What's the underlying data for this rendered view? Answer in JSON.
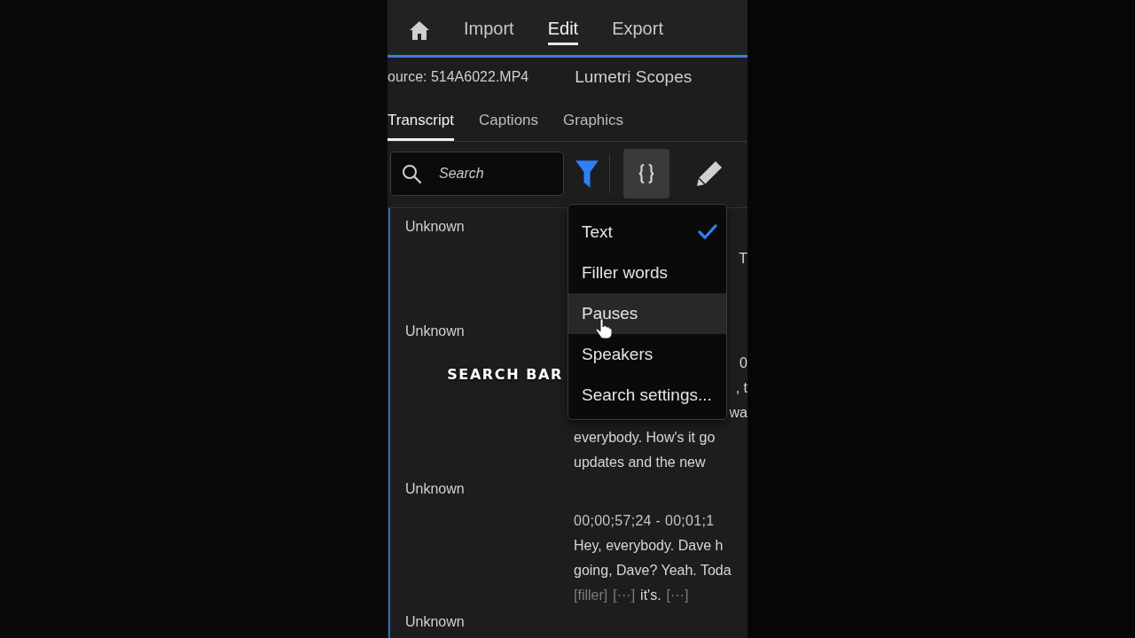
{
  "nav": {
    "items": [
      {
        "label": "Import",
        "selected": false
      },
      {
        "label": "Edit",
        "selected": true
      },
      {
        "label": "Export",
        "selected": false
      }
    ]
  },
  "panel_tabs": [
    "ource: 514A6022.MP4",
    "Lumetri Scopes"
  ],
  "tabs": [
    {
      "label": "Transcript",
      "selected": true
    },
    {
      "label": "Captions",
      "selected": false
    },
    {
      "label": "Graphics",
      "selected": false
    }
  ],
  "toolbar": {
    "search": {
      "placeholder": "Search"
    },
    "buttons": [
      {
        "kind": "filter",
        "active": true
      },
      {
        "kind": "braces",
        "active": true
      },
      {
        "kind": "pencil",
        "active": false
      }
    ]
  },
  "filter_menu": {
    "items": [
      {
        "kind": "option",
        "label": "Text",
        "checked": true,
        "hovered": false
      },
      {
        "kind": "option",
        "label": "Filler words",
        "checked": false,
        "hovered": false
      },
      {
        "kind": "option",
        "label": "Pauses",
        "checked": false,
        "hovered": true
      },
      {
        "kind": "option",
        "label": "Speakers",
        "checked": false,
        "hovered": false
      },
      {
        "kind": "action",
        "label": "Search settings...",
        "hovered": false
      }
    ]
  },
  "transcript": {
    "segments": [
      {
        "speaker": "Unknown",
        "lines": [
          {
            "kind": "fragment",
            "text": "T"
          }
        ]
      },
      {
        "speaker": "Unknown",
        "lines": [
          {
            "kind": "fragment",
            "text": "0"
          },
          {
            "kind": "fragment",
            "text": ", t"
          },
          {
            "kind": "fragment",
            "text": "wa"
          },
          {
            "kind": "text",
            "text": "everybody. How's it go"
          },
          {
            "kind": "text",
            "text": "updates and the new"
          }
        ]
      },
      {
        "speaker": "Unknown",
        "lines": [
          {
            "kind": "timecode",
            "text": "00;00;57;24 - 00;01;1"
          },
          {
            "kind": "text",
            "text": "Hey, everybody. Dave h"
          },
          {
            "kind": "text",
            "text": "going, Dave? Yeah. Toda"
          },
          {
            "kind": "tokens",
            "tokens": [
              {
                "kind": "filler",
                "text": "[filler]"
              },
              {
                "kind": "pause",
                "text": "[···]"
              },
              {
                "kind": "word",
                "text": "it's."
              },
              {
                "kind": "pause",
                "text": "[···]"
              }
            ]
          }
        ]
      },
      {
        "speaker": "Unknown"
      }
    ]
  },
  "caption": "SEARCH BAR"
}
